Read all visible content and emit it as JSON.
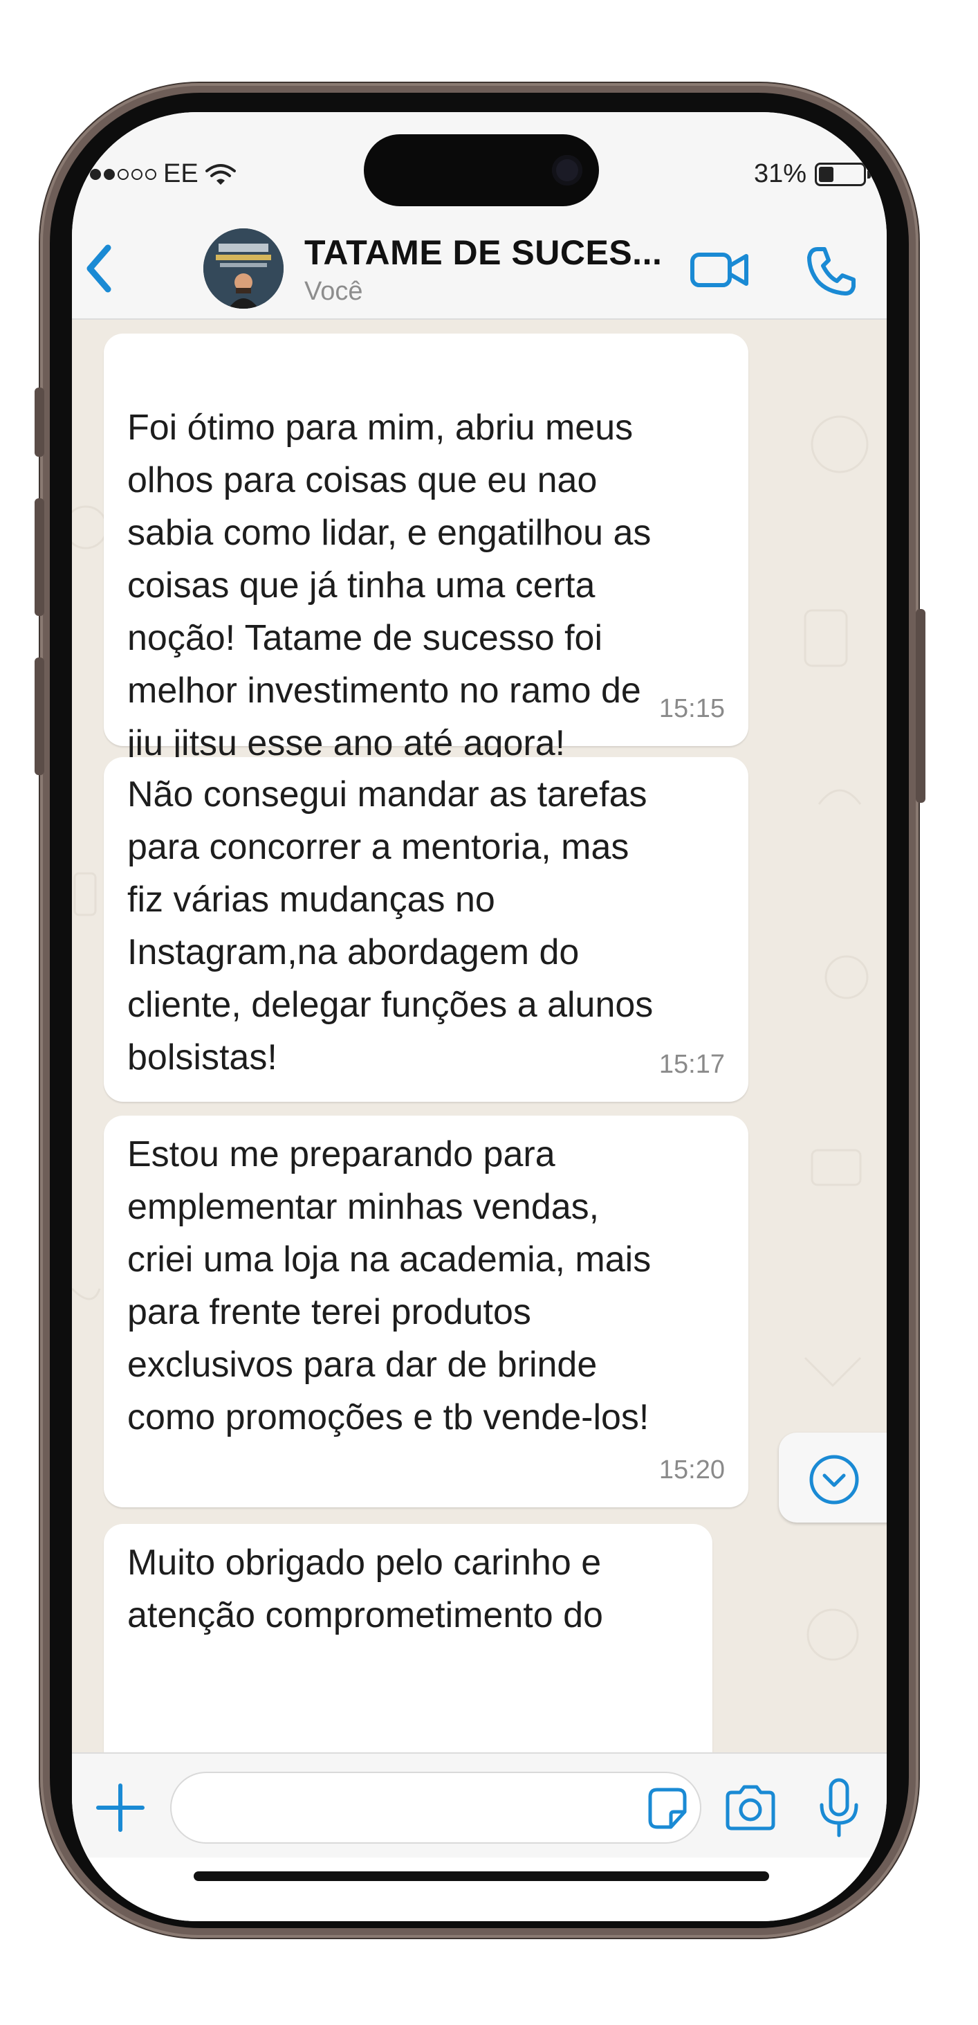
{
  "status_bar": {
    "carrier": "EE",
    "battery": "31%",
    "battery_level": 0.31
  },
  "header": {
    "title": "TATAME DE SUCES...",
    "subtitle": "Você"
  },
  "messages": [
    {
      "text": "\nFoi ótimo para mim, abriu meus\nolhos para coisas que eu nao\nsabia como lidar, e engatilhou as\ncoisas que já tinha uma certa\nnoção! Tatame de sucesso foi\nmelhor investimento no ramo de\njiu jitsu esse ano até agora!",
      "time": "15:15"
    },
    {
      "text": "Não consegui mandar as tarefas\npara concorrer a mentoria, mas\nfiz  várias mudanças no\nInstagram,na abordagem do\ncliente, delegar funções a alunos\nbolsistas!",
      "time": "15:17"
    },
    {
      "text": "Estou me preparando para\nemplementar minhas vendas,\ncriei uma  loja na academia, mais\npara frente terei produtos\nexclusivos para dar de brinde\ncomo promoções e tb vende-los!",
      "time": "15:20"
    },
    {
      "text": "Muito obrigado pelo carinho e\natenção comprometimento do",
      "time": ""
    }
  ],
  "colors": {
    "accent": "#1a8ad4",
    "chat_background": "#efeae2",
    "bubble": "#ffffff"
  },
  "icons": {
    "back": "chevron-left-icon",
    "video": "video-camera-icon",
    "call": "phone-icon",
    "scroll": "chevron-down-circle-icon",
    "attach": "plus-icon",
    "sticker": "sticker-icon",
    "camera": "camera-icon",
    "mic": "microphone-icon"
  }
}
